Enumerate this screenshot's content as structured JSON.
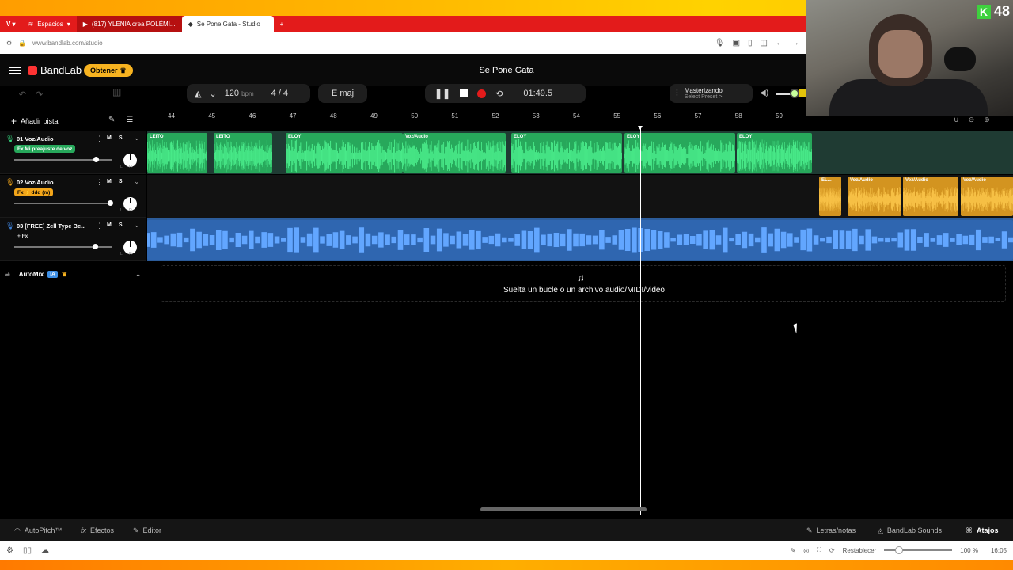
{
  "browser": {
    "tabs": [
      {
        "label": "Espacios"
      },
      {
        "label": "(817) YLENIA crea POLÉMI..."
      },
      {
        "label": "Se Pone Gata - Studio"
      }
    ],
    "new_tab": "+",
    "url": "www.bandlab.com/studio",
    "nav_back": "←",
    "nav_forward": "→"
  },
  "webcam": {
    "badge_count": "48",
    "badge_letter": "K"
  },
  "studio": {
    "logo": "BandLab",
    "get_button": "Obtener",
    "song_title": "Se Pone Gata",
    "tempo": "120",
    "tempo_unit": "bpm",
    "time_signature": "4 / 4",
    "key": "E maj",
    "time": "01:49.5",
    "mastering_title": "Masterizando",
    "mastering_preset": "Select Preset >"
  },
  "sidebar": {
    "add_track": "Añadir pista",
    "automix": "AutoMix",
    "automix_badge": "IA"
  },
  "ruler": {
    "bars": [
      "44",
      "45",
      "46",
      "47",
      "48",
      "49",
      "50",
      "51",
      "52",
      "53",
      "54",
      "55",
      "56",
      "57",
      "58",
      "59"
    ]
  },
  "tracks": [
    {
      "name": "01  Voz/Audio",
      "fx": "Fx Mi preajuste de voz",
      "color": "#27a85b",
      "volume": 0.83,
      "mic_color": "#33d17a"
    },
    {
      "name": "02  Voz/Audio",
      "fx": "Fx ⚡ddd (m)",
      "color": "#f2a51a",
      "volume": 0.98,
      "mic_color": "#f2a51a"
    },
    {
      "name": "03  [FREE] Zell Type Be...",
      "fx": "+ Fx",
      "color": "#3d7fd6",
      "volume": 0.82,
      "mic_color": "#3d7fd6"
    }
  ],
  "clips": {
    "track1": [
      {
        "label": "LEITO"
      },
      {
        "label": "LEITO"
      },
      {
        "label": "ELOY"
      },
      {
        "label": "Voz/Audio"
      },
      {
        "label": "ELOY"
      },
      {
        "label": "ELOY"
      },
      {
        "label": "ELOY"
      }
    ],
    "track2": [
      {
        "label": "EL..."
      },
      {
        "label": "Voz/Audio"
      },
      {
        "label": "Voz/Audio"
      },
      {
        "label": "Voz/Audio"
      }
    ]
  },
  "drop_zone": {
    "text": "Suelta un bucle o un archivo audio/MIDI/video"
  },
  "bottom_bar": {
    "autopitch": "AutoPitch™",
    "effects": "Efectos",
    "editor": "Editor",
    "lyrics": "Letras/notas",
    "sounds": "BandLab Sounds",
    "shortcuts": "Atajos"
  },
  "status_bar": {
    "reset": "Restablecer",
    "zoom": "100 %",
    "clock": "16:05"
  }
}
